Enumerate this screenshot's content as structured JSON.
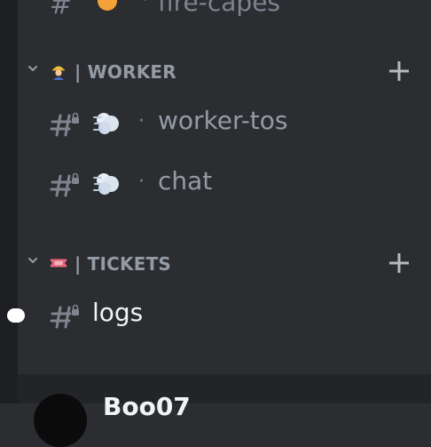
{
  "top_partial_channel": {
    "icon": "hash-icon",
    "emoji": "fire-emoji",
    "name": "fire-capes"
  },
  "categories": [
    {
      "name": "| WORKER",
      "emoji": "construction-worker-emoji",
      "channels": [
        {
          "name": "worker-tos",
          "emoji": "dash-emoji",
          "separator": "·",
          "locked": true
        },
        {
          "name": "chat",
          "emoji": "dash-emoji",
          "separator": "·",
          "locked": true
        }
      ]
    },
    {
      "name": "| TICKETS",
      "emoji": "ticket-emoji",
      "channels": [
        {
          "name": "logs",
          "locked": true,
          "unread": true,
          "active": true
        }
      ]
    }
  ],
  "user_panel": {
    "username": "Boo07"
  },
  "colors": {
    "background": "#2b2d31",
    "server_rail": "#1e1f22",
    "muted_text": "#949ba4",
    "active_text": "#f2f3f5"
  }
}
